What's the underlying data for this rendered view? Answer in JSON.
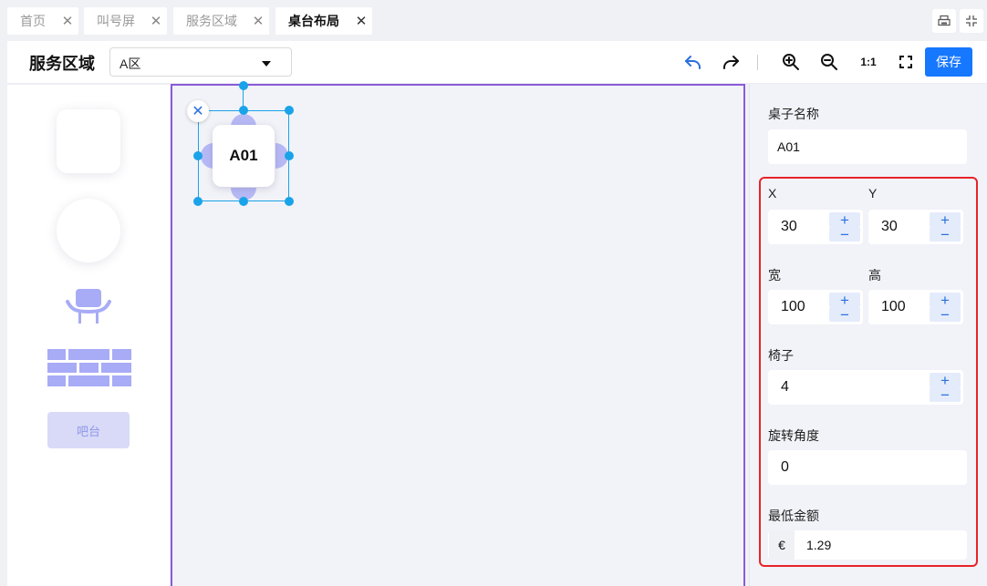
{
  "tabs": [
    {
      "label": "首页",
      "close": "✕"
    },
    {
      "label": "叫号屏",
      "close": "✕"
    },
    {
      "label": "服务区域",
      "close": "✕"
    },
    {
      "label": "桌台布局",
      "close": "✕"
    }
  ],
  "header": {
    "title": "服务区域",
    "area_select": "A区",
    "ratio_label": "1:1",
    "save_label": "保存"
  },
  "palette": {
    "bar_label": "吧台"
  },
  "canvas": {
    "table_label": "A01",
    "delete_glyph": "✕"
  },
  "panel": {
    "name_label": "桌子名称",
    "name_value": "A01",
    "x_label": "X",
    "x_value": "30",
    "y_label": "Y",
    "y_value": "30",
    "width_label": "宽",
    "width_value": "100",
    "height_label": "高",
    "height_value": "100",
    "chairs_label": "椅子",
    "chairs_value": "4",
    "rotation_label": "旋转角度",
    "rotation_value": "0",
    "min_amount_label": "最低金额",
    "currency": "€",
    "min_amount_value": "1.29",
    "plus": "+",
    "minus": "−"
  },
  "colors": {
    "primary": "#1677ff",
    "canvas_border": "#8a5bd8",
    "selection": "#1aa3e8",
    "seat": "#b7b9f5",
    "highlight": "#e8232a"
  }
}
